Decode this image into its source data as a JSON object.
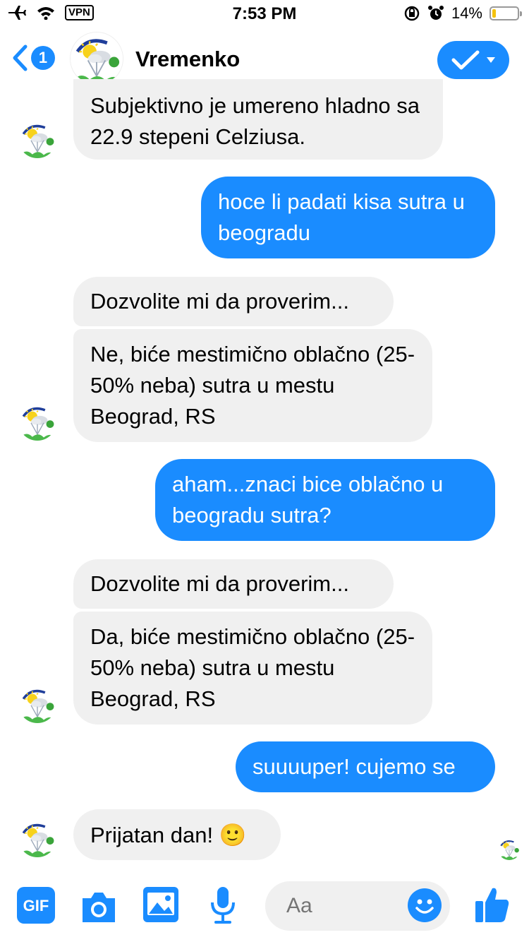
{
  "status": {
    "vpn": "VPN",
    "time": "7:53 PM",
    "battery": "14%",
    "battery_level": 0.14
  },
  "header": {
    "back_count": "1",
    "title": "Vremenko"
  },
  "messages": [
    {
      "from": "bot",
      "text": "Subjektivno je umereno hladno sa 22.9 stepeni Celziusa."
    },
    {
      "from": "user",
      "text": "hoce li padati kisa sutra u beogradu"
    },
    {
      "from": "bot",
      "text": "Dozvolite mi da proverim..."
    },
    {
      "from": "bot",
      "text": "Ne, biće mestimično oblačno (25-50% neba) sutra u mestu Beograd, RS"
    },
    {
      "from": "user",
      "text": "aham...znaci bice oblačno u beogradu sutra?"
    },
    {
      "from": "bot",
      "text": "Dozvolite mi da proverim..."
    },
    {
      "from": "bot",
      "text": "Da, biće mestimično oblačno (25-50% neba) sutra u mestu Beograd, RS"
    },
    {
      "from": "user",
      "text": "suuuuper! cujemo se"
    },
    {
      "from": "bot",
      "text": "Prijatan dan! 🙂"
    }
  ],
  "composer": {
    "gif_label": "GIF",
    "placeholder": "Aa",
    "icons": [
      "gif-icon",
      "camera-icon",
      "image-icon",
      "microphone-icon",
      "emoji-icon",
      "thumbs-up-icon"
    ]
  },
  "colors": {
    "accent": "#1a8cff",
    "incoming_bubble": "#f0f0f0",
    "battery_low": "#f4c20d"
  }
}
